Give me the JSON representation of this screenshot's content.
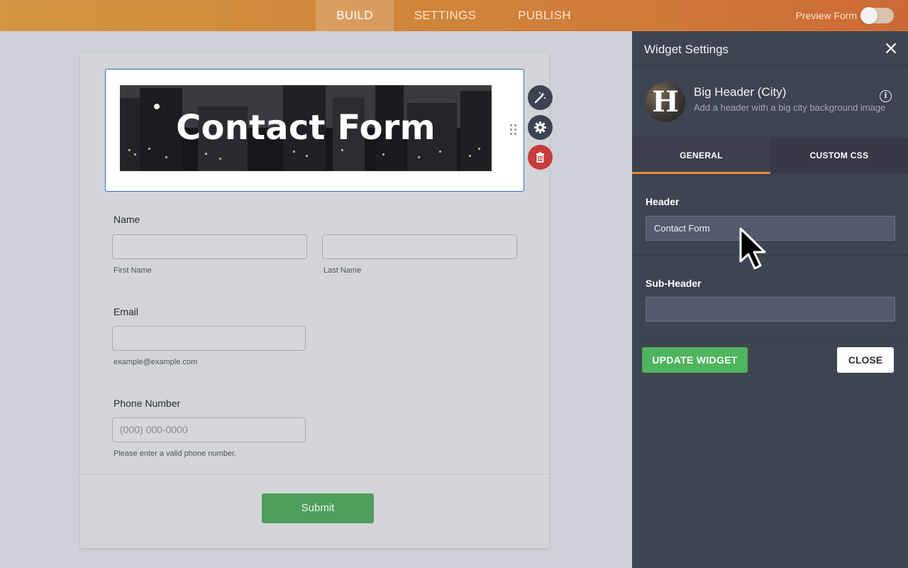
{
  "topbar": {
    "tabs": [
      {
        "label": "BUILD",
        "active": true
      },
      {
        "label": "SETTINGS",
        "active": false
      },
      {
        "label": "PUBLISH",
        "active": false
      }
    ],
    "preview_label": "Preview Form",
    "preview_enabled": false
  },
  "form": {
    "header_title": "Contact Form",
    "fields": {
      "name_label": "Name",
      "first_name_sub": "First Name",
      "last_name_sub": "Last Name",
      "email_label": "Email",
      "email_sub": "example@example.com",
      "phone_label": "Phone Number",
      "phone_placeholder": "(000) 000-0000",
      "phone_sub": "Please enter a valid phone number."
    },
    "submit_label": "Submit"
  },
  "panel": {
    "title": "Widget Settings",
    "widget_name": "Big Header (City)",
    "widget_description": "Add a header with a big city background image",
    "avatar_letter": "H",
    "tabs": [
      {
        "label": "GENERAL",
        "active": true
      },
      {
        "label": "CUSTOM CSS",
        "active": false
      }
    ],
    "header_label": "Header",
    "header_value": "Contact Form",
    "subheader_label": "Sub-Header",
    "subheader_value": "",
    "update_label": "UPDATE WIDGET",
    "close_label": "CLOSE"
  },
  "colors": {
    "topbar_start": "#d3953f",
    "topbar_end": "#cc6a35",
    "panel_bg": "#3f4451",
    "tab_accent": "#e8843a",
    "update_green": "#4eb45e",
    "submit_green": "#4e9e5e",
    "delete_red": "#c73c3c",
    "selection_blue": "#2f6fd6"
  },
  "icons": [
    "wand-icon",
    "gear-icon",
    "trash-icon",
    "drag-handle-icon",
    "close-icon",
    "info-icon",
    "cursor-icon"
  ]
}
